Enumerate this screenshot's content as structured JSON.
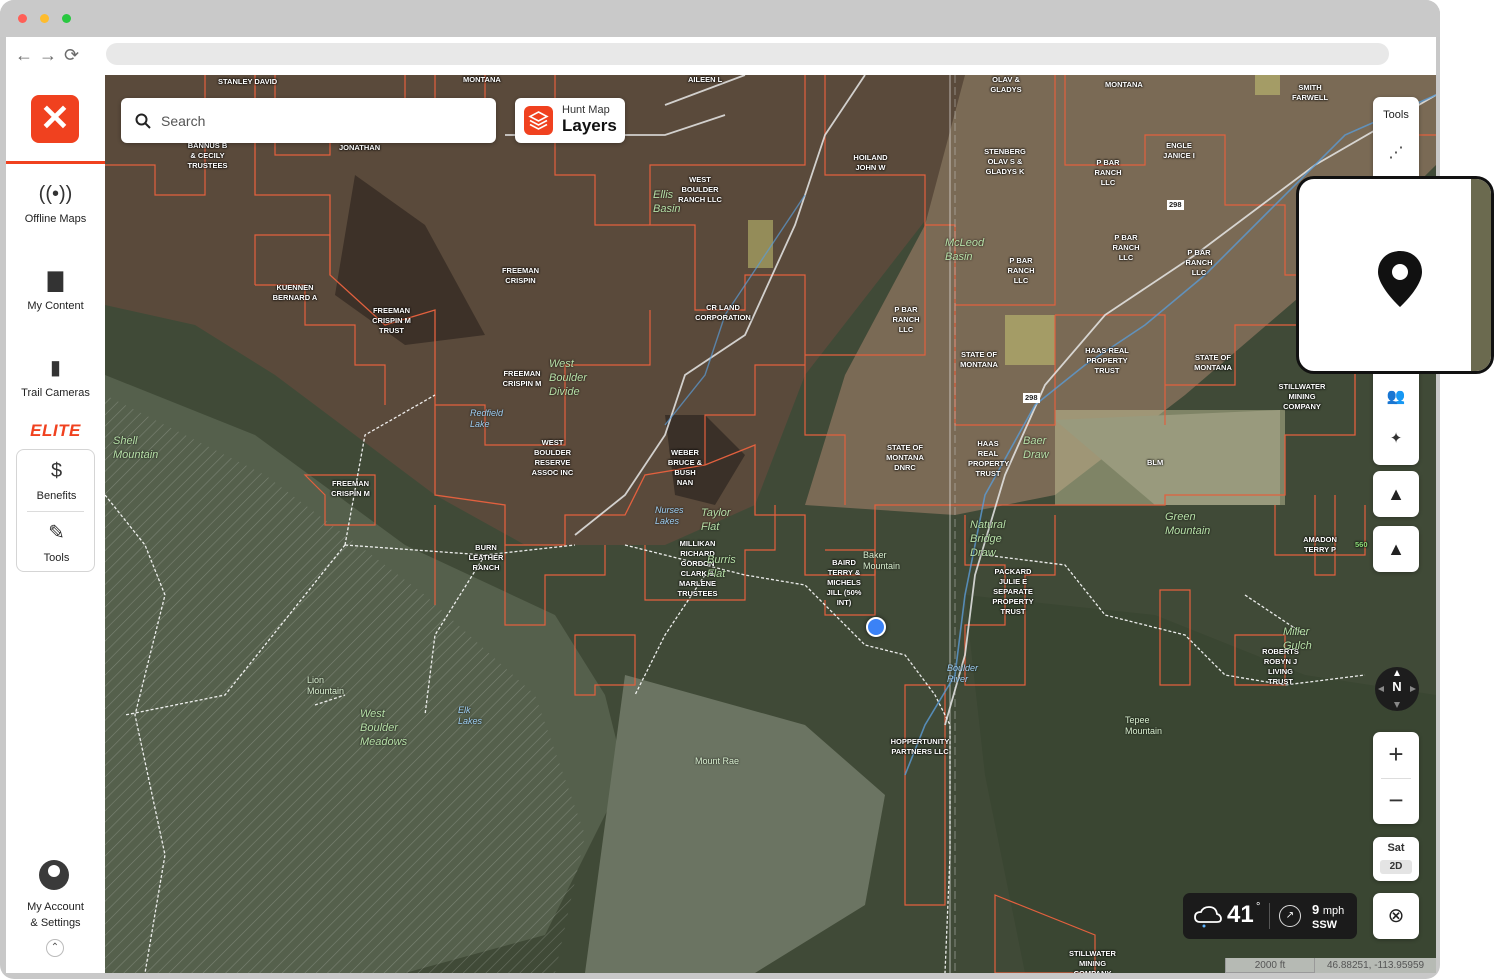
{
  "browser": {
    "traffic_lights": [
      "#ff5f57",
      "#febc2e",
      "#28c840"
    ],
    "nav": {
      "back": "←",
      "forward": "→",
      "reload": "⟳"
    }
  },
  "sidebar": {
    "logo_glyph": "✕",
    "items": [
      {
        "label": "Offline Maps",
        "icon": "broadcast-icon"
      },
      {
        "label": "My Content",
        "icon": "folder-icon"
      },
      {
        "label": "Trail Cameras",
        "icon": "trail-camera-icon"
      }
    ],
    "elite_label": "ELITE",
    "elite_items": [
      {
        "label": "Benefits",
        "icon": "dollar-circle-icon"
      },
      {
        "label": "Tools",
        "icon": "tools-icon"
      }
    ],
    "account_label_line1": "My Account",
    "account_label_line2": "& Settings",
    "accent_color": "#f0411f"
  },
  "search": {
    "placeholder": "Search"
  },
  "layers": {
    "top": "Hunt Map",
    "main": "Layers"
  },
  "tools": {
    "label": "Tools"
  },
  "map_view": {
    "layer": "Sat",
    "mode": "2D"
  },
  "weather": {
    "temp": "41",
    "deg": "°",
    "wind_speed": "9",
    "wind_unit": "mph",
    "wind_dir": "SSW"
  },
  "scale": "2000 ft",
  "coords": "46.88251, -113.95959",
  "compass": "N",
  "owners": [
    "STANLEY DAVID",
    "MONTANA",
    "AILEEN L",
    "OLAV & GLADYS",
    "MONTANA",
    "SMITH FARWELL",
    "BANNUS B & CECILY TRUSTEES",
    "JONATHAN",
    "HOILAND JOHN W",
    "STENBERG OLAV S & GLADYS K",
    "P BAR RANCH LLC",
    "ENGLE JANICE I",
    "WEST BOULDER RANCH LLC",
    "KUENNEN BERNARD A",
    "FREEMAN CRISPIN",
    "FREEMAN CRISPIN M TRUST",
    "CR LAND CORPORATION",
    "P BAR RANCH LLC",
    "P BAR RANCH LLC",
    "P BAR RANCH LLC",
    "P BAR RANCH LLC",
    "STATE OF MONTANA",
    "HAAS REAL PROPERTY TRUST",
    "STATE OF MONTANA",
    "STILLWATER MINING COMPANY",
    "FREEMAN CRISPIN M",
    "WEST BOULDER RESERVE ASSOC INC",
    "WEBER BRUCE & BUSH NAN",
    "STATE OF MONTANA DNRC",
    "HAAS REAL PROPERTY TRUST",
    "BLM",
    "FREEMAN CRISPIN M",
    "BURN LEATHER RANCH",
    "MILLIKAN RICHARD GORDON CLARK & MARLENE TRUSTEES",
    "BAIRD TERRY & MICHELS JILL (50% INT)",
    "PACKARD JULIE E SEPARATE PROPERTY TRUST",
    "AMADON TERRY P",
    "ROBERTS ROBYN J LIVING TRUST",
    "HOPPERTUNITY PARTNERS LLC",
    "STILLWATER MINING COMPANY"
  ],
  "geo_labels": [
    "Ellis Basin",
    "McLeod Basin",
    "West Boulder Divide",
    "Shell Mountain",
    "Taylor Flat",
    "Burris Flat",
    "Baer Draw",
    "Natural Bridge Draw",
    "Green Mountain",
    "Miller Gulch",
    "West Boulder Meadows"
  ],
  "water_labels": [
    "Redfield Lake",
    "Nurses Lakes",
    "Elk Lakes",
    "Boulder River"
  ],
  "peaks": [
    "Baker Mountain",
    "Lion Mountain",
    "Mount Rae",
    "Tepee Mountain"
  ],
  "roads": [
    "298",
    "298",
    "560"
  ]
}
